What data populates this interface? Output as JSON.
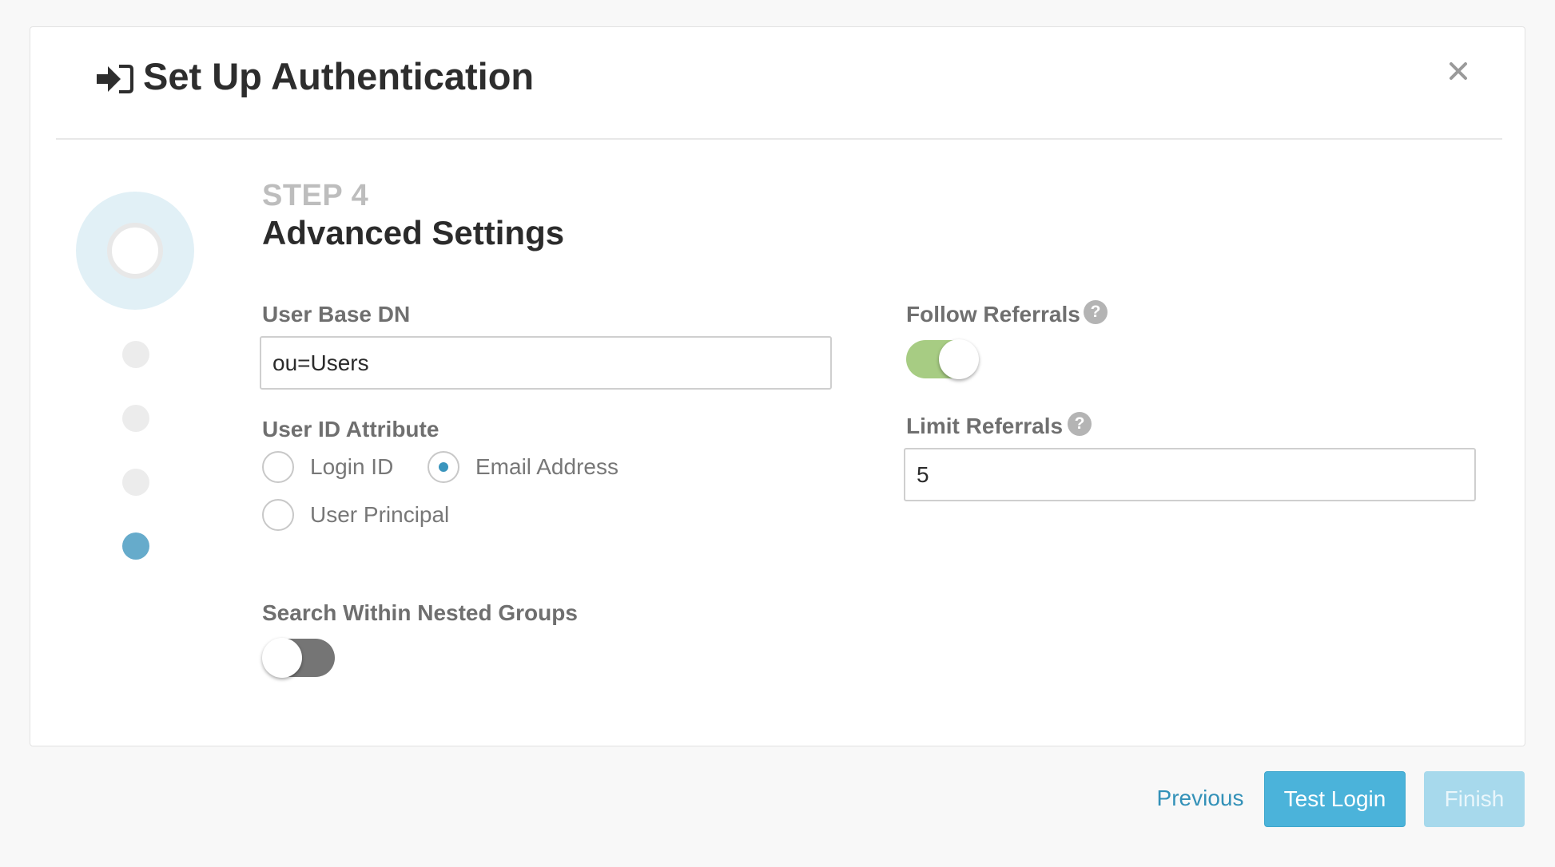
{
  "modal": {
    "title": "Set Up Authentication",
    "title_icon": "sign-in-icon",
    "close_icon": "close-icon"
  },
  "stepper": {
    "current_step": 4,
    "total_steps": 4
  },
  "step": {
    "label": "STEP 4",
    "title": "Advanced Settings"
  },
  "form": {
    "user_base_dn": {
      "label": "User Base DN",
      "value": "ou=Users"
    },
    "user_id_attribute": {
      "label": "User ID Attribute",
      "options": [
        "Login ID",
        "Email Address",
        "User Principal"
      ],
      "selected": "Email Address"
    },
    "search_nested_groups": {
      "label": "Search Within Nested Groups",
      "enabled": false
    },
    "follow_referrals": {
      "label": "Follow Referrals",
      "enabled": true,
      "help_icon": "?"
    },
    "limit_referrals": {
      "label": "Limit Referrals",
      "value": "5",
      "help_icon": "?"
    }
  },
  "footer": {
    "previous_label": "Previous",
    "test_login_label": "Test Login",
    "finish_label": "Finish"
  },
  "colors": {
    "accent": "#4bb3da",
    "link": "#3391b8",
    "toggle_on": "#a7cc83",
    "toggle_off": "#757575",
    "step_active": "#66abcb"
  }
}
